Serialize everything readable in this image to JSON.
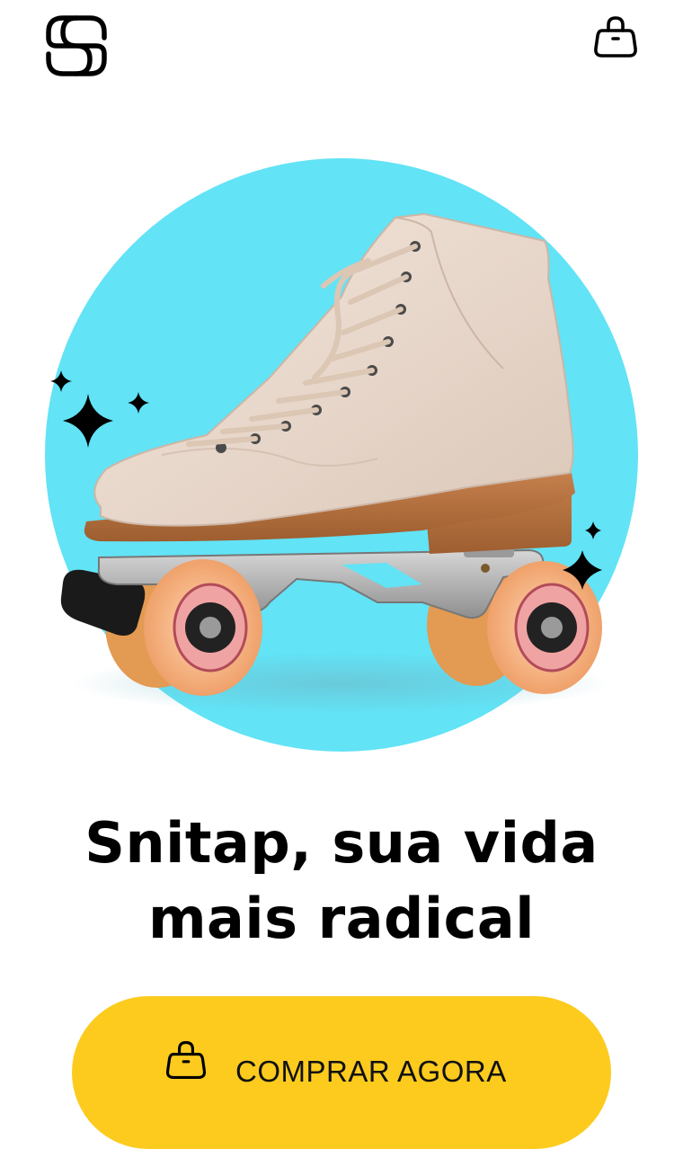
{
  "header": {
    "logo_icon": "brand-logo-icon",
    "cart_icon": "shopping-bag-icon"
  },
  "hero": {
    "product_image": "roller-skate",
    "circle_color": "#62e3f6",
    "sparkle_icon": "sparkle-icon"
  },
  "headline": {
    "line1": "Snitap, sua vida",
    "line2": "mais radical"
  },
  "cta": {
    "label": "COMPRAR AGORA",
    "icon": "shopping-bag-icon",
    "color": "#fccb1e"
  }
}
